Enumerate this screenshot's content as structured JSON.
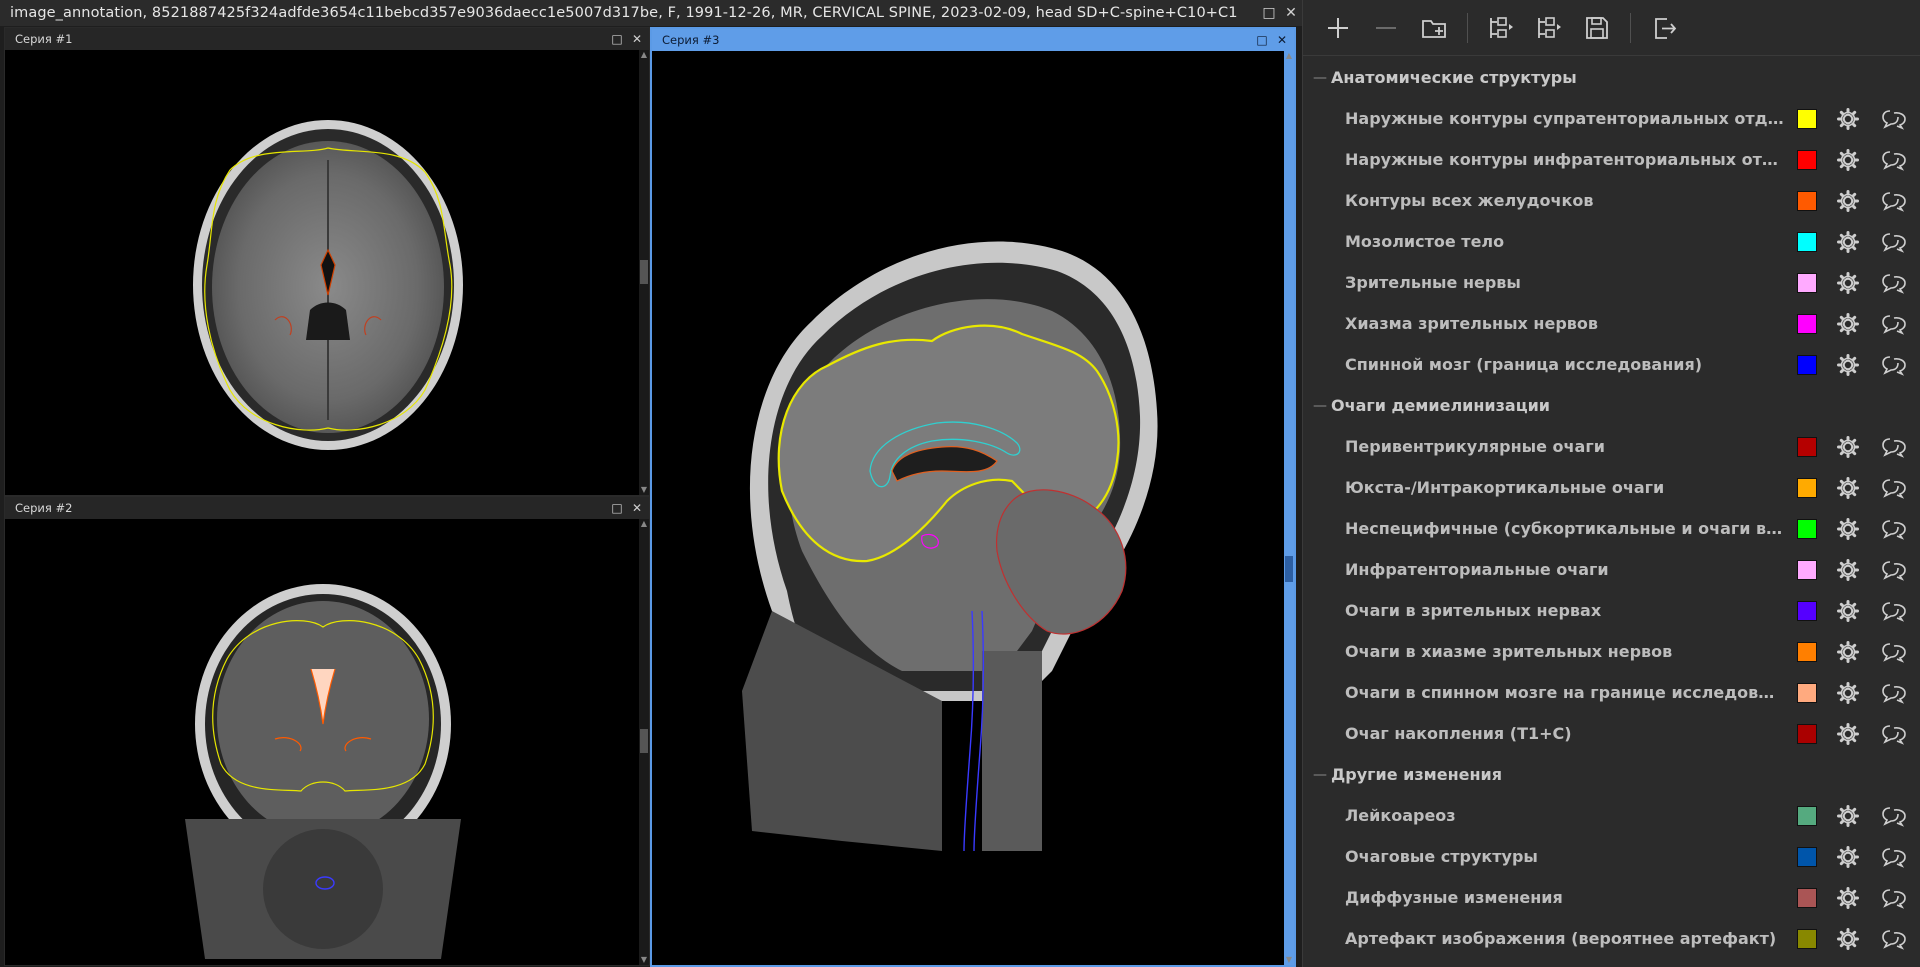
{
  "window": {
    "title": "image_annotation, 8521887425f324adfde3654c11bebcd357e9036daecc1e5007d317be, F, 1991-12-26, MR, CERVICAL SPINE, 2023-02-09, head SD+C-spine+C10+C1",
    "maximize": "□",
    "close": "✕"
  },
  "panels": {
    "series1": {
      "label": "Серия #1",
      "maximize": "□",
      "close": "✕"
    },
    "series2": {
      "label": "Серия #2",
      "maximize": "□",
      "close": "✕"
    },
    "series3": {
      "label": "Серия #3",
      "maximize": "□",
      "close": "✕"
    }
  },
  "icons": {
    "toolbar": [
      "plus-icon",
      "minus-icon",
      "folder-add-icon",
      "tree-collapse-icon",
      "tree-expand-icon",
      "save-icon",
      "exit-icon"
    ],
    "row": [
      "gear-icon",
      "comment-icon"
    ]
  },
  "groups": [
    {
      "name": "Анатомические структуры",
      "items": [
        {
          "label": "Наружные контуры супратенториальных отделов головного мозга",
          "color": "#ffff00"
        },
        {
          "label": "Наружные контуры инфратенториальных отделов головного мозга",
          "color": "#ff0000"
        },
        {
          "label": "Контуры всех желудочков",
          "color": "#ff5a00"
        },
        {
          "label": "Мозолистое тело",
          "color": "#00ffff"
        },
        {
          "label": "Зрительные нервы",
          "color": "#ffaaff"
        },
        {
          "label": "Хиазма зрительных нервов",
          "color": "#ff00ff"
        },
        {
          "label": "Спинной мозг (граница исследования)",
          "color": "#0000ff"
        }
      ]
    },
    {
      "name": "Очаги демиелинизации",
      "items": [
        {
          "label": "Перивентрикулярные очаги",
          "color": "#b50000"
        },
        {
          "label": "Юкста-/Интракортикальные очаги",
          "color": "#ffaa00"
        },
        {
          "label": "Неспецифичные (субкортикальные и очаги в глубоком белом веществе)",
          "color": "#00ff00"
        },
        {
          "label": "Инфратенториальные очаги",
          "color": "#ffaaff"
        },
        {
          "label": "Очаги в зрительных нервах",
          "color": "#5500ff"
        },
        {
          "label": "Очаги в хиазме зрительных нервов",
          "color": "#ff7f00"
        },
        {
          "label": "Очаги в спинном мозге на границе исследования",
          "color": "#ffaa7f"
        },
        {
          "label": "Очаг накопления (Т1+С)",
          "color": "#aa0000"
        }
      ]
    },
    {
      "name": "Другие изменения",
      "items": [
        {
          "label": "Лейкоареоз",
          "color": "#55aa7f"
        },
        {
          "label": "Очаговые структуры",
          "color": "#0055aa"
        },
        {
          "label": "Диффузные изменения",
          "color": "#aa5555"
        },
        {
          "label": "Артефакт изображения (вероятнее артефакт)",
          "color": "#888800"
        }
      ]
    }
  ]
}
